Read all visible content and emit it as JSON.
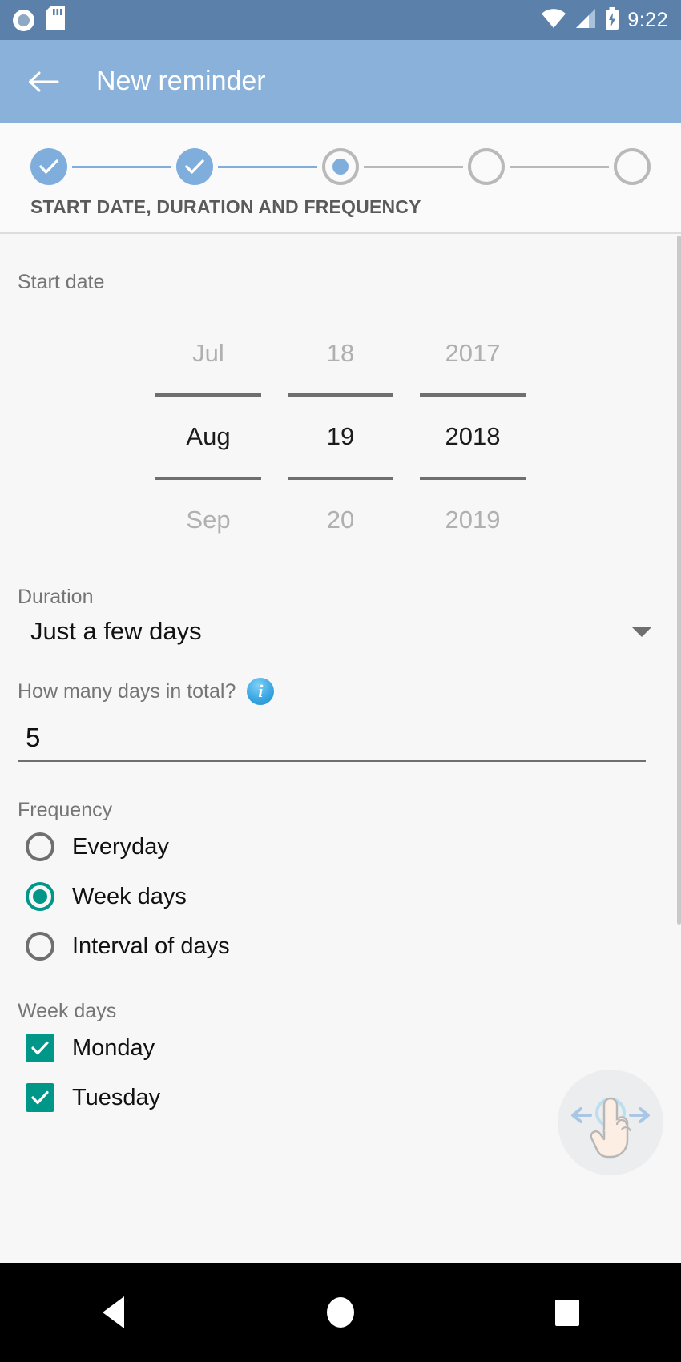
{
  "status_bar": {
    "icons_left": [
      "screen-record-icon",
      "sd-card-icon"
    ],
    "icons_right": [
      "wifi-icon",
      "cellular-signal-icon",
      "battery-charging-icon"
    ],
    "time": "9:22"
  },
  "app_bar": {
    "back_icon": "back-arrow-icon",
    "title": "New reminder"
  },
  "stepper": {
    "label": "START DATE, DURATION AND FREQUENCY",
    "total_steps": 5,
    "current_step": 3,
    "steps": [
      {
        "index": 1,
        "state": "done"
      },
      {
        "index": 2,
        "state": "done"
      },
      {
        "index": 3,
        "state": "active"
      },
      {
        "index": 4,
        "state": "todo"
      },
      {
        "index": 5,
        "state": "todo"
      }
    ],
    "accent_color": "#7faedd",
    "inactive_color": "#b9b9b9"
  },
  "start_date": {
    "label": "Start date",
    "month": {
      "previous": "Jul",
      "selected": "Aug",
      "next": "Sep"
    },
    "day": {
      "previous": "18",
      "selected": "19",
      "next": "20"
    },
    "year": {
      "previous": "2017",
      "selected": "2018",
      "next": "2019"
    }
  },
  "duration": {
    "label": "Duration",
    "selected": "Just a few days",
    "dropdown_icon": "chevron-down-icon"
  },
  "days_total": {
    "question": "How many days in total?",
    "info_icon": "info-icon",
    "value": "5"
  },
  "frequency": {
    "label": "Frequency",
    "options": [
      {
        "label": "Everyday",
        "selected": false
      },
      {
        "label": "Week days",
        "selected": true
      },
      {
        "label": "Interval of days",
        "selected": false
      }
    ],
    "selected_color": "#009688"
  },
  "week_days": {
    "label": "Week days",
    "days": [
      {
        "label": "Monday",
        "checked": true
      },
      {
        "label": "Tuesday",
        "checked": true
      }
    ],
    "checked_color": "#009688"
  },
  "gesture_hint": {
    "icon": "swipe-hand-icon"
  },
  "nav_bar": {
    "back": "back-nav-icon",
    "home": "home-nav-icon",
    "recents": "recents-nav-icon"
  }
}
